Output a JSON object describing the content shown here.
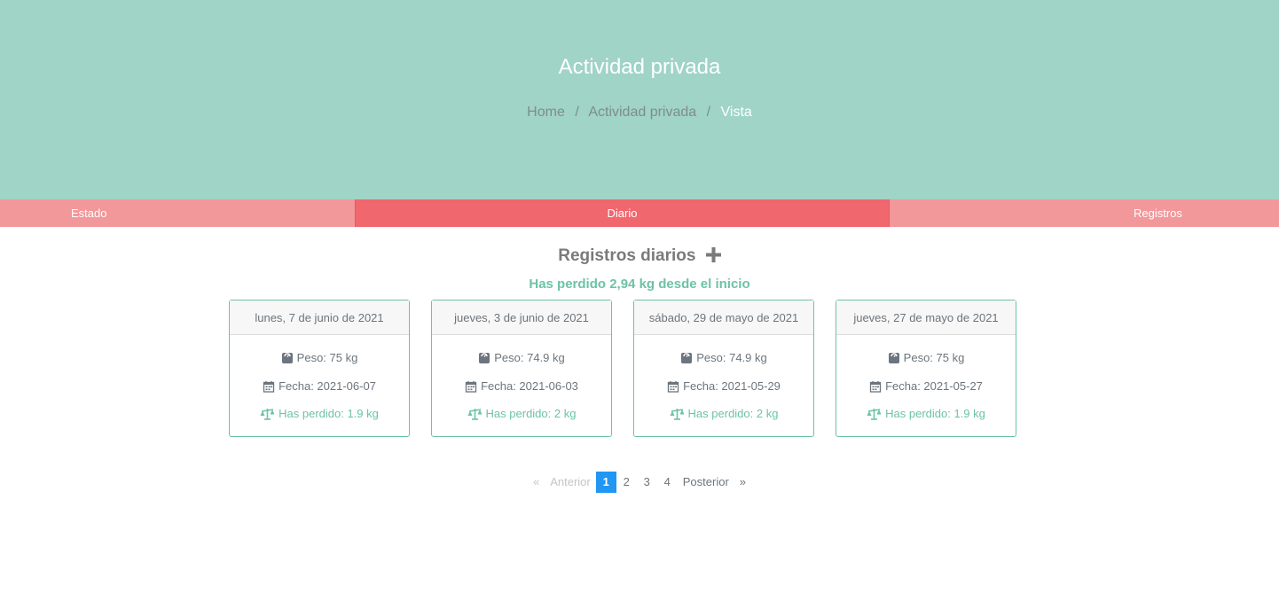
{
  "hero": {
    "title": "Actividad privada",
    "breadcrumb": {
      "home": "Home",
      "section": "Actividad privada",
      "current": "Vista",
      "separator": "/"
    }
  },
  "tabs": [
    {
      "label": "Estado",
      "active": false
    },
    {
      "label": "Diario",
      "active": true
    },
    {
      "label": "Registros",
      "active": false
    }
  ],
  "section": {
    "title": "Registros diarios",
    "add_icon": "plus-icon",
    "summary": "Has perdido 2,94 kg desde el inicio"
  },
  "cards": [
    {
      "date": "lunes, 7 de junio de 2021",
      "peso": "Peso: 75 kg",
      "fecha": "Fecha: 2021-06-07",
      "perdido": "Has perdido: 1.9 kg"
    },
    {
      "date": "jueves, 3 de junio de 2021",
      "peso": "Peso: 74.9 kg",
      "fecha": "Fecha: 2021-06-03",
      "perdido": "Has perdido: 2 kg"
    },
    {
      "date": "sábado, 29 de mayo de 2021",
      "peso": "Peso: 74.9 kg",
      "fecha": "Fecha: 2021-05-29",
      "perdido": "Has perdido: 2 kg"
    },
    {
      "date": "jueves, 27 de mayo de 2021",
      "peso": "Peso: 75 kg",
      "fecha": "Fecha: 2021-05-27",
      "perdido": "Has perdido: 1.9 kg"
    }
  ],
  "pagination": {
    "prev_arrow": "«",
    "prev": "Anterior",
    "pages": [
      "1",
      "2",
      "3",
      "4"
    ],
    "current_page": "1",
    "next": "Posterior",
    "next_arrow": "»"
  },
  "colors": {
    "hero_bg": "#9fd4c6",
    "tab_bg": "#f2979a",
    "tab_active_bg": "#f0676e",
    "accent_green": "#6cc3a5",
    "pagination_active": "#2196f3"
  }
}
